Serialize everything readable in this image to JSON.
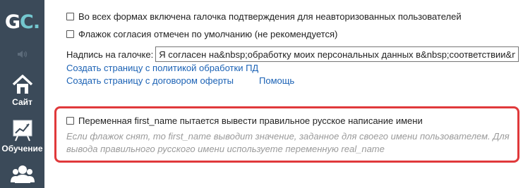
{
  "sidebar": {
    "logo": {
      "main": "G",
      "accent": "C."
    },
    "items": [
      {
        "icon": "home-icon",
        "label": "Сайт"
      },
      {
        "icon": "chart-icon",
        "label": "Обучение"
      },
      {
        "icon": "users-icon",
        "label": ""
      }
    ]
  },
  "settings": {
    "checkbox_unauth_label": "Во всех формах включена галочка подтверждения для неавторизованных пользователей",
    "checkbox_default_label": "Флажок согласия отмечен по умолчанию (не рекомендуется)",
    "caption_label": "Надпись на галочке:",
    "caption_value": "Я согласен на&nbsp;обработку моих персональных данных в&nbsp;соответствии&nbsp;",
    "link_policy": "Создать страницу с политикой обработки ПД",
    "link_offer": "Создать страницу с договором оферты",
    "link_help": "Помощь",
    "checkbox_firstname_label": "Переменная first_name пытается вывести правильное русское написание имени",
    "firstname_help": "Если флажок снят, то first_name выводит значение, заданное для своего имени пользователем. Для вывода правильного русского имени используете переменную real_name"
  },
  "colors": {
    "sidebar_bg": "#3b4a59",
    "logo_accent": "#74c7cf",
    "link": "#1b62b5",
    "highlight_border": "#e0393b",
    "help_text": "#9a9a9a"
  }
}
